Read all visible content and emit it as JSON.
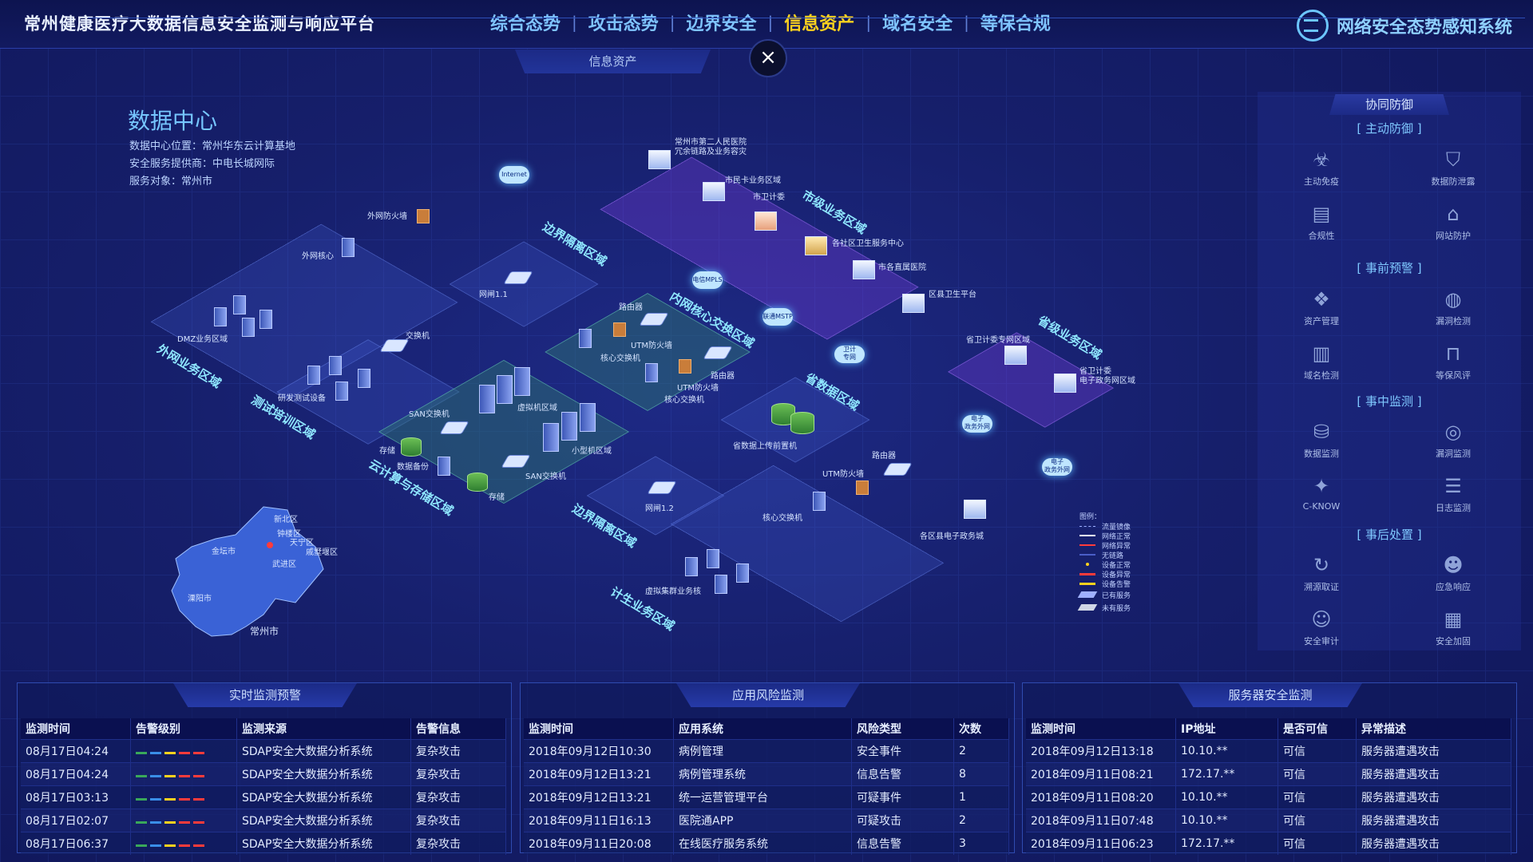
{
  "header": {
    "app_title": "常州健康医疗大数据信息安全监测与响应平台",
    "tabs": [
      "综合态势",
      "攻击态势",
      "边界安全",
      "信息资产",
      "域名安全",
      "等保合规"
    ],
    "active_tab": "信息资产",
    "separator": "|",
    "brand": "网络安全态势感知系统"
  },
  "module": {
    "tab": "信息资产",
    "close_glyph": "×"
  },
  "datacenter": {
    "title": "数据中心",
    "location": "数据中心位置：常州华东云计算基地",
    "provider": "安全服务提供商：中电长城网际",
    "audience": "服务对象：常州市"
  },
  "zones": {
    "extranet": "外网业务区域",
    "test": "测试培训区域",
    "border1": "边界隔离区域",
    "core": "内网核心交换区域",
    "cloud": "云计算与存储区域",
    "city": "市级业务区域",
    "province": "省级业务区域",
    "provdata": "省数据区域",
    "border2": "边界隔离区域",
    "planning": "计生业务区域"
  },
  "nodes": {
    "ext_fw": "外网防火墙",
    "ext_core": "外网核心",
    "dmz": "DMZ业务区域",
    "gate1": "网闸1.1",
    "switch": "交换机",
    "rnd": "研发测试设备",
    "router1": "路由器",
    "utm1": "UTM防火墙",
    "core_sw1": "核心交换机",
    "router2": "路由器",
    "utm2": "UTM防火墙",
    "core_sw2": "核心交换机",
    "vm": "虚拟机区域",
    "minicomp": "小型机区域",
    "san1": "SAN交换机",
    "store1": "存储",
    "backup": "数据备份",
    "store2": "存储",
    "san2": "SAN交换机",
    "hosp2": "常州市第二人民医院\n冗余链路及业务容灾",
    "citizen": "市民卡业务区域",
    "health_commission": "市卫计委",
    "community": "各社区卫生服务中心",
    "city_hosp": "市各直属医院",
    "district": "区县卫生平台",
    "prov_net": "省卫计委专网区域",
    "prov_gov": "省卫计委\n电子政务网区域",
    "prov_upload": "省数据上传前置机",
    "gate2": "网闸1.2",
    "router3": "路由器",
    "utm3": "UTM防火墙",
    "core_sw3": "核心交换机",
    "vcluster": "虚拟集群业务核",
    "egov": "各区县电子政务城"
  },
  "clouds": {
    "internet": "Internet",
    "mpls": "电信MPLS",
    "mstp": "联通MSTP",
    "gov1": "卫计\n专网",
    "egov1": "电子\n政务外网",
    "egov2": "电子\n政务外网"
  },
  "map": {
    "districts": [
      "新北区",
      "钟楼区",
      "天宁区",
      "戚墅堰区",
      "武进区",
      "金坛市",
      "溧阳市"
    ],
    "city": "常州市"
  },
  "legend": {
    "title": "图例：",
    "items": [
      "流量镜像",
      "网络正常",
      "网络异常",
      "无链路",
      "设备正常",
      "设备异常",
      "设备告警",
      "已有服务",
      "未有服务"
    ],
    "colors": [
      "#9fb0ff",
      "#ffffff",
      "#ff3b3b",
      "#4a5ec8",
      "#ffd21e",
      "#ff3b3b",
      "#ffd21e",
      "#9fb0ff",
      "#cfd6e6"
    ]
  },
  "right_panel": {
    "title": "协同防御",
    "groups": [
      {
        "name": "[ 主动防御 ]",
        "items": [
          {
            "label": "主动免疫",
            "icon": "virus-shield-icon"
          },
          {
            "label": "数据防泄露",
            "icon": "shield-d-icon"
          },
          {
            "label": "合规性",
            "icon": "book-icon"
          },
          {
            "label": "网站防护",
            "icon": "home-icon"
          }
        ]
      },
      {
        "name": "[ 事前预警 ]",
        "items": [
          {
            "label": "资产管理",
            "icon": "asset-icon"
          },
          {
            "label": "漏洞检测",
            "icon": "globe-scan-icon"
          },
          {
            "label": "域名检测",
            "icon": "bar-chart-icon"
          },
          {
            "label": "等保风评",
            "icon": "lock-icon"
          }
        ]
      },
      {
        "name": "[ 事中监测 ]",
        "items": [
          {
            "label": "数据监测",
            "icon": "database-search-icon"
          },
          {
            "label": "漏洞监测",
            "icon": "radar-icon"
          },
          {
            "label": "C-KNOW",
            "icon": "cknow-icon"
          },
          {
            "label": "日志监测",
            "icon": "log-icon"
          }
        ]
      },
      {
        "name": "[ 事后处置 ]",
        "items": [
          {
            "label": "溯源取证",
            "icon": "refresh-icon"
          },
          {
            "label": "应急响应",
            "icon": "user-alert-icon"
          },
          {
            "label": "安全审计",
            "icon": "user-audit-icon"
          },
          {
            "label": "安全加固",
            "icon": "bricks-icon"
          }
        ]
      }
    ]
  },
  "alerts": {
    "title": "实时监测预警",
    "columns": [
      "监测时间",
      "告警级别",
      "监测来源",
      "告警信息"
    ],
    "rows": [
      [
        "08月17日04:24",
        "",
        "SDAP安全大数据分析系统",
        "复杂攻击"
      ],
      [
        "08月17日04:24",
        "",
        "SDAP安全大数据分析系统",
        "复杂攻击"
      ],
      [
        "08月17日03:13",
        "",
        "SDAP安全大数据分析系统",
        "复杂攻击"
      ],
      [
        "08月17日02:07",
        "",
        "SDAP安全大数据分析系统",
        "复杂攻击"
      ],
      [
        "08月17日06:37",
        "",
        "SDAP安全大数据分析系统",
        "复杂攻击"
      ]
    ],
    "level_colors": [
      "#3aa85a",
      "#3a8ee8",
      "#ffd21e",
      "#ff3b3b",
      "#ff3b3b"
    ]
  },
  "app_risk": {
    "title": "应用风险监测",
    "columns": [
      "监测时间",
      "应用系统",
      "风险类型",
      "次数"
    ],
    "rows": [
      [
        "2018年09月12日10:30",
        "病例管理",
        "安全事件",
        "2"
      ],
      [
        "2018年09月12日13:21",
        "病例管理系统",
        "信息告警",
        "8"
      ],
      [
        "2018年09月12日13:21",
        "统一运营管理平台",
        "可疑事件",
        "1"
      ],
      [
        "2018年09月11日16:13",
        "医院通APP",
        "可疑攻击",
        "2"
      ],
      [
        "2018年09月11日20:08",
        "在线医疗服务系统",
        "信息告警",
        "3"
      ]
    ]
  },
  "server_sec": {
    "title": "服务器安全监测",
    "columns": [
      "监测时间",
      "IP地址",
      "是否可信",
      "异常描述"
    ],
    "rows": [
      [
        "2018年09月12日13:18",
        "10.10.**",
        "可信",
        "服务器遭遇攻击"
      ],
      [
        "2018年09月11日08:21",
        "172.17.**",
        "可信",
        "服务器遭遇攻击"
      ],
      [
        "2018年09月11日08:20",
        "10.10.**",
        "可信",
        "服务器遭遇攻击"
      ],
      [
        "2018年09月11日07:48",
        "10.10.**",
        "可信",
        "服务器遭遇攻击"
      ],
      [
        "2018年09月11日06:23",
        "172.17.**",
        "可信",
        "服务器遭遇攻击"
      ]
    ]
  }
}
